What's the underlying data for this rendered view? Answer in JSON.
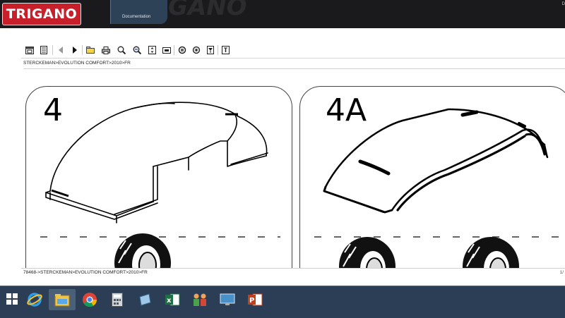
{
  "app": {
    "logo_text": "TRIGANO",
    "watermark_text": "GANO",
    "tab_label": "Documentation",
    "corner_text": "D",
    "colors": {
      "brand": "#c8202a",
      "topbar": "#1a1a1c",
      "taskbar": "#2c3e55"
    }
  },
  "toolbar": {
    "buttons": [
      "window-icon",
      "panel-icon",
      "back-icon",
      "forward-icon",
      "folder-icon",
      "print-icon",
      "zoom-icon",
      "zoom-area-icon",
      "fit-page-icon",
      "fit-width-icon",
      "rotate-icon",
      "settings-icon",
      "filter-icon",
      "info-icon"
    ]
  },
  "breadcrumb": {
    "top": "STERCKEMAN>EVOLUTION COMFORT>2010>FR"
  },
  "panels": [
    {
      "label": "4"
    },
    {
      "label": "4A"
    }
  ],
  "status": {
    "path": "78468->STERCKEMAN>EVOLUTION COMFORT>2010>FR",
    "page": "1/"
  },
  "taskbar": {
    "items": [
      "start-icon",
      "internet-explorer-icon",
      "file-explorer-icon",
      "chrome-icon",
      "calculator-icon",
      "generic-app-icon",
      "excel-icon",
      "people-app-icon",
      "remote-desktop-icon",
      "powerpoint-icon"
    ]
  }
}
